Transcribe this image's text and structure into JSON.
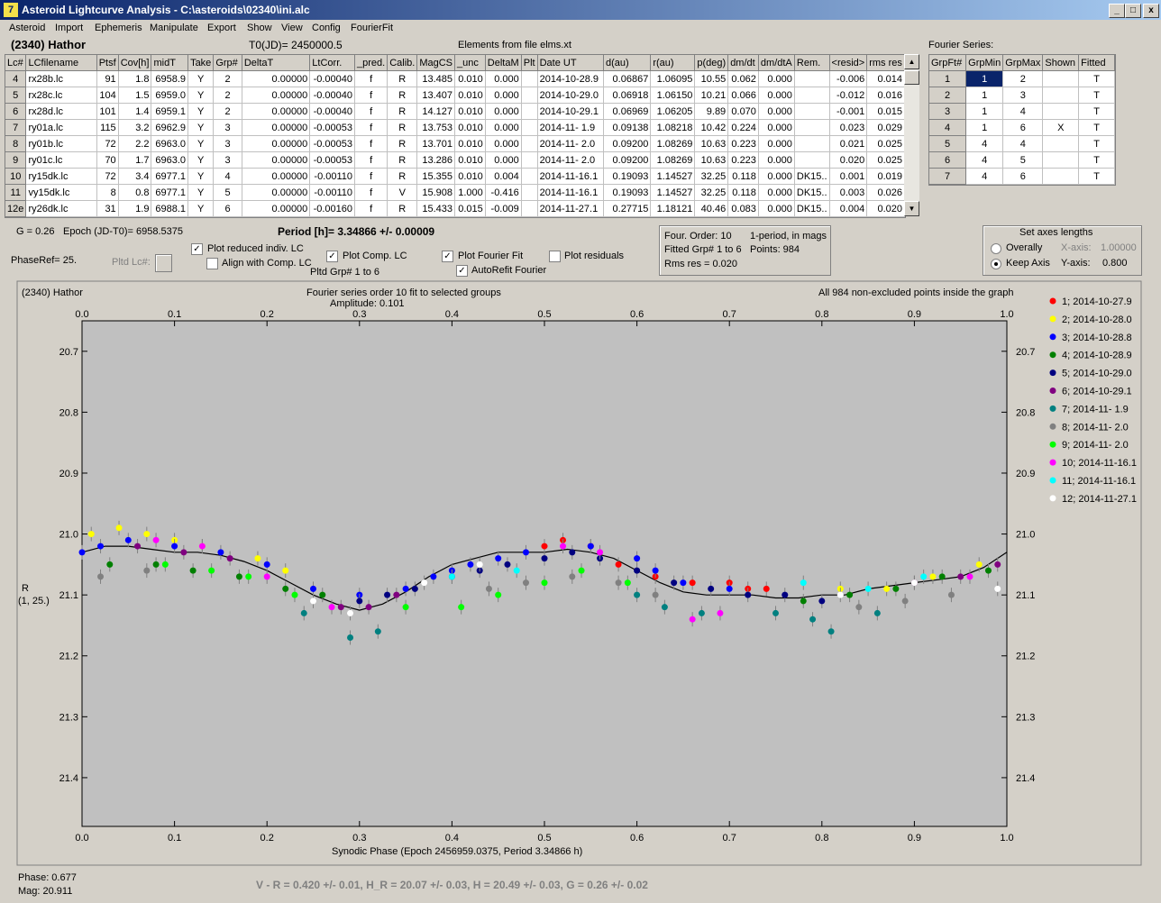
{
  "window": {
    "title": "Asteroid Lightcurve Analysis - C:\\asteroids\\02340\\ini.alc",
    "min_icon": "minimize-icon",
    "max_icon": "maximize-icon",
    "close_icon": "close-icon"
  },
  "menu": [
    "Asteroid",
    "Import",
    "Ephemeris",
    "Manipulate",
    "Export",
    "Show",
    "View",
    "Config",
    "FourierFit"
  ],
  "header": {
    "object": "(2340) Hathor",
    "t0": "T0(JD)= 2450000.5",
    "elements": "Elements from file elms.xt",
    "fourier_series": "Fourier Series:"
  },
  "lc_table": {
    "columns": [
      "Lc#",
      "LCfilename",
      "Ptsf",
      "Cov[h]",
      "midT",
      "Take",
      "Grp#",
      "DeltaT",
      "LtCorr.",
      "_pred.",
      "Calib.",
      "MagCS",
      "_unc",
      "DeltaM",
      "Plt",
      "Date UT",
      "d(au)",
      "r(au)",
      "p(deg)",
      "dm/dt",
      "dm/dtA",
      "Rem.",
      "<resid>",
      "rms res"
    ],
    "rows": [
      [
        "4",
        "rx28b.lc",
        "91",
        "1.8",
        "6958.9",
        "Y",
        "2",
        "0.00000",
        "-0.00040",
        "f",
        "R",
        "13.485",
        "0.010",
        "0.000",
        "",
        "2014-10-28.9",
        "0.06867",
        "1.06095",
        "10.55",
        "0.062",
        "0.000",
        "",
        "-0.006",
        "0.014"
      ],
      [
        "5",
        "rx28c.lc",
        "104",
        "1.5",
        "6959.0",
        "Y",
        "2",
        "0.00000",
        "-0.00040",
        "f",
        "R",
        "13.407",
        "0.010",
        "0.000",
        "",
        "2014-10-29.0",
        "0.06918",
        "1.06150",
        "10.21",
        "0.066",
        "0.000",
        "",
        "-0.012",
        "0.016"
      ],
      [
        "6",
        "rx28d.lc",
        "101",
        "1.4",
        "6959.1",
        "Y",
        "2",
        "0.00000",
        "-0.00040",
        "f",
        "R",
        "14.127",
        "0.010",
        "0.000",
        "",
        "2014-10-29.1",
        "0.06969",
        "1.06205",
        "9.89",
        "0.070",
        "0.000",
        "",
        "-0.001",
        "0.015"
      ],
      [
        "7",
        "ry01a.lc",
        "115",
        "3.2",
        "6962.9",
        "Y",
        "3",
        "0.00000",
        "-0.00053",
        "f",
        "R",
        "13.753",
        "0.010",
        "0.000",
        "",
        "2014-11- 1.9",
        "0.09138",
        "1.08218",
        "10.42",
        "0.224",
        "0.000",
        "",
        "0.023",
        "0.029"
      ],
      [
        "8",
        "ry01b.lc",
        "72",
        "2.2",
        "6963.0",
        "Y",
        "3",
        "0.00000",
        "-0.00053",
        "f",
        "R",
        "13.701",
        "0.010",
        "0.000",
        "",
        "2014-11- 2.0",
        "0.09200",
        "1.08269",
        "10.63",
        "0.223",
        "0.000",
        "",
        "0.021",
        "0.025"
      ],
      [
        "9",
        "ry01c.lc",
        "70",
        "1.7",
        "6963.0",
        "Y",
        "3",
        "0.00000",
        "-0.00053",
        "f",
        "R",
        "13.286",
        "0.010",
        "0.000",
        "",
        "2014-11- 2.0",
        "0.09200",
        "1.08269",
        "10.63",
        "0.223",
        "0.000",
        "",
        "0.020",
        "0.025"
      ],
      [
        "10",
        "ry15dk.lc",
        "72",
        "3.4",
        "6977.1",
        "Y",
        "4",
        "0.00000",
        "-0.00110",
        "f",
        "R",
        "15.355",
        "0.010",
        "0.004",
        "",
        "2014-11-16.1",
        "0.19093",
        "1.14527",
        "32.25",
        "0.118",
        "0.000",
        "DK15..",
        "0.001",
        "0.019"
      ],
      [
        "11",
        "vy15dk.lc",
        "8",
        "0.8",
        "6977.1",
        "Y",
        "5",
        "0.00000",
        "-0.00110",
        "f",
        "V",
        "15.908",
        "1.000",
        "-0.416",
        "",
        "2014-11-16.1",
        "0.19093",
        "1.14527",
        "32.25",
        "0.118",
        "0.000",
        "DK15..",
        "0.003",
        "0.026"
      ],
      [
        "12e",
        "ry26dk.lc",
        "31",
        "1.9",
        "6988.1",
        "Y",
        "6",
        "0.00000",
        "-0.00160",
        "f",
        "R",
        "15.433",
        "0.015",
        "-0.009",
        "",
        "2014-11-27.1",
        "0.27715",
        "1.18121",
        "40.46",
        "0.083",
        "0.000",
        "DK15..",
        "0.004",
        "0.020"
      ]
    ]
  },
  "fourier_table": {
    "columns": [
      "GrpFt#",
      "GrpMin",
      "GrpMax",
      "Shown",
      "Fitted"
    ],
    "rows": [
      [
        "1",
        "1",
        "2",
        "",
        "T"
      ],
      [
        "2",
        "1",
        "3",
        "",
        "T"
      ],
      [
        "3",
        "1",
        "4",
        "",
        "T"
      ],
      [
        "4",
        "1",
        "6",
        "X",
        "T"
      ],
      [
        "5",
        "4",
        "4",
        "",
        "T"
      ],
      [
        "6",
        "4",
        "5",
        "",
        "T"
      ],
      [
        "7",
        "4",
        "6",
        "",
        "T"
      ]
    ]
  },
  "controls": {
    "g": "G = 0.26",
    "epoch": "Epoch (JD-T0)= 6958.5375",
    "period": "Period [h]= 3.34866 +/- 0.00009",
    "phaseref": "PhaseRef= 25.",
    "pltd_lc": "Pltd Lc#:",
    "plot_reduced": "Plot reduced indiv. LC",
    "align_comp": "Align with Comp. LC",
    "plot_comp": "Plot Comp. LC",
    "pltd_grp": "Pltd Grp#  1   to   6",
    "plot_fourier": "Plot Fourier Fit",
    "autorefit": "AutoRefit Fourier",
    "plot_residuals": "Plot residuals",
    "four_order": "Four. Order: 10",
    "one_period": "1-period, in mags",
    "fitted_grp": "Fitted Grp# 1 to 6",
    "points": "Points: 984",
    "rms": "Rms res     = 0.020",
    "axes_title": "Set axes lengths",
    "overally": "Overally",
    "keep_axis": "Keep Axis",
    "xaxis": "X-axis:",
    "xaxis_val": "1.00000",
    "yaxis": "Y-axis:",
    "yaxis_val": "0.800"
  },
  "plot": {
    "title_left": "(2340) Hathor",
    "title_center": "Fourier series order 10 fit to selected groups",
    "amplitude": "Amplitude: 0.101",
    "title_right": "All 984 non-excluded points inside the graph",
    "ylabel1": "R",
    "ylabel2": "(1, 25.)",
    "xlabel": "Synodic Phase (Epoch 2456959.0375, Period 3.34866 h)"
  },
  "footer": {
    "phase": "Phase:  0.677",
    "mag": "Mag:    20.911",
    "summary": "V - R = 0.420 +/- 0.01, H_R = 20.07 +/- 0.03, H = 20.49 +/- 0.03, G = 0.26 +/- 0.02"
  },
  "chart_data": {
    "type": "scatter",
    "x_range": [
      0,
      1
    ],
    "y_range": [
      20.65,
      21.48
    ],
    "y_inverted": true,
    "x_ticks": [
      0,
      0.1,
      0.2,
      0.3,
      0.4,
      0.5,
      0.6,
      0.7,
      0.8,
      0.9,
      1.0
    ],
    "x_tick_labels": [
      "0.0",
      "0.1",
      "0.2",
      "0.3",
      "0.4",
      "0.5",
      "0.6",
      "0.7",
      "0.8",
      "0.9",
      "1.0"
    ],
    "y_ticks": [
      20.7,
      20.8,
      20.9,
      21.0,
      21.1,
      21.2,
      21.3,
      21.4
    ],
    "y_tick_labels": [
      "20.7",
      "20.8",
      "20.9",
      "21.0",
      "21.1",
      "21.2",
      "21.3",
      "21.4"
    ],
    "fourier_curve": {
      "x": [
        0,
        0.025,
        0.05,
        0.075,
        0.1,
        0.125,
        0.15,
        0.175,
        0.2,
        0.225,
        0.25,
        0.275,
        0.3,
        0.325,
        0.35,
        0.375,
        0.4,
        0.425,
        0.45,
        0.475,
        0.5,
        0.525,
        0.55,
        0.575,
        0.6,
        0.625,
        0.65,
        0.675,
        0.7,
        0.725,
        0.75,
        0.775,
        0.8,
        0.825,
        0.85,
        0.875,
        0.9,
        0.925,
        0.95,
        0.975,
        1.0
      ],
      "y": [
        21.03,
        21.02,
        21.02,
        21.025,
        21.03,
        21.03,
        21.035,
        21.045,
        21.06,
        21.08,
        21.1,
        21.115,
        21.125,
        21.115,
        21.095,
        21.07,
        21.05,
        21.04,
        21.03,
        21.03,
        21.03,
        21.025,
        21.03,
        21.04,
        21.06,
        21.08,
        21.095,
        21.1,
        21.1,
        21.1,
        21.105,
        21.105,
        21.1,
        21.1,
        21.09,
        21.085,
        21.08,
        21.075,
        21.07,
        21.055,
        21.03
      ]
    },
    "legend_placement": "right",
    "series": [
      {
        "name": "1; 2014-10-27.9",
        "color": "#ff0000",
        "x": [
          0.5,
          0.52,
          0.55,
          0.58,
          0.62,
          0.66,
          0.7,
          0.72,
          0.74
        ],
        "y": [
          21.02,
          21.01,
          21.02,
          21.05,
          21.07,
          21.08,
          21.08,
          21.09,
          21.09
        ]
      },
      {
        "name": "2; 2014-10-28.0",
        "color": "#ffff00",
        "x": [
          0.01,
          0.04,
          0.07,
          0.1,
          0.13,
          0.19,
          0.22,
          0.82,
          0.87,
          0.92,
          0.97
        ],
        "y": [
          21.0,
          20.99,
          21.0,
          21.01,
          21.02,
          21.04,
          21.06,
          21.09,
          21.09,
          21.07,
          21.05
        ]
      },
      {
        "name": "3; 2014-10-28.8",
        "color": "#0000ff",
        "x": [
          0.0,
          0.02,
          0.05,
          0.1,
          0.15,
          0.2,
          0.25,
          0.3,
          0.35,
          0.38,
          0.4,
          0.42,
          0.45,
          0.48,
          0.55,
          0.6,
          0.62,
          0.65,
          0.7
        ],
        "y": [
          21.03,
          21.02,
          21.01,
          21.02,
          21.03,
          21.05,
          21.09,
          21.1,
          21.09,
          21.07,
          21.06,
          21.05,
          21.04,
          21.03,
          21.02,
          21.04,
          21.06,
          21.08,
          21.09
        ]
      },
      {
        "name": "4; 2014-10-28.9",
        "color": "#008000",
        "x": [
          0.03,
          0.08,
          0.12,
          0.17,
          0.22,
          0.26,
          0.78,
          0.83,
          0.88,
          0.93,
          0.98
        ],
        "y": [
          21.05,
          21.05,
          21.06,
          21.07,
          21.09,
          21.1,
          21.11,
          21.1,
          21.09,
          21.07,
          21.06
        ]
      },
      {
        "name": "5; 2014-10-29.0",
        "color": "#000080",
        "x": [
          0.3,
          0.33,
          0.36,
          0.4,
          0.43,
          0.46,
          0.5,
          0.53,
          0.56,
          0.6,
          0.64,
          0.68,
          0.72,
          0.76,
          0.8
        ],
        "y": [
          21.11,
          21.1,
          21.09,
          21.07,
          21.06,
          21.05,
          21.04,
          21.03,
          21.04,
          21.06,
          21.08,
          21.09,
          21.1,
          21.1,
          21.11
        ]
      },
      {
        "name": "6; 2014-10-29.1",
        "color": "#800080",
        "x": [
          0.06,
          0.11,
          0.16,
          0.28,
          0.31,
          0.34,
          0.9,
          0.95,
          0.99
        ],
        "y": [
          21.02,
          21.03,
          21.04,
          21.12,
          21.12,
          21.1,
          21.08,
          21.07,
          21.05
        ]
      },
      {
        "name": "7; 2014-11- 1.9",
        "color": "#008080",
        "x": [
          0.24,
          0.29,
          0.32,
          0.6,
          0.63,
          0.67,
          0.75,
          0.79,
          0.81,
          0.86
        ],
        "y": [
          21.13,
          21.17,
          21.16,
          21.1,
          21.12,
          21.13,
          21.13,
          21.14,
          21.16,
          21.13
        ]
      },
      {
        "name": "8; 2014-11- 2.0",
        "color": "#808080",
        "x": [
          0.02,
          0.07,
          0.44,
          0.48,
          0.53,
          0.58,
          0.62,
          0.84,
          0.89,
          0.94
        ],
        "y": [
          21.07,
          21.06,
          21.09,
          21.08,
          21.07,
          21.08,
          21.1,
          21.12,
          21.11,
          21.1
        ]
      },
      {
        "name": "9; 2014-11- 2.0",
        "color": "#00ff00",
        "x": [
          0.09,
          0.14,
          0.18,
          0.23,
          0.35,
          0.41,
          0.45,
          0.5,
          0.54,
          0.59
        ],
        "y": [
          21.05,
          21.06,
          21.07,
          21.1,
          21.12,
          21.12,
          21.1,
          21.08,
          21.06,
          21.08
        ]
      },
      {
        "name": "10; 2014-11-16.1",
        "color": "#ff00ff",
        "x": [
          0.08,
          0.13,
          0.2,
          0.27,
          0.52,
          0.56,
          0.66,
          0.69,
          0.96
        ],
        "y": [
          21.01,
          21.02,
          21.07,
          21.12,
          21.02,
          21.03,
          21.14,
          21.13,
          21.07
        ]
      },
      {
        "name": "11; 2014-11-16.1",
        "color": "#00ffff",
        "x": [
          0.4,
          0.47,
          0.78,
          0.85,
          0.91
        ],
        "y": [
          21.07,
          21.06,
          21.08,
          21.09,
          21.07
        ]
      },
      {
        "name": "12; 2014-11-27.1",
        "color": "#ffffff",
        "x": [
          0.25,
          0.29,
          0.37,
          0.43,
          0.82,
          0.9,
          0.99
        ],
        "y": [
          21.11,
          21.13,
          21.08,
          21.05,
          21.1,
          21.08,
          21.09
        ]
      }
    ]
  }
}
